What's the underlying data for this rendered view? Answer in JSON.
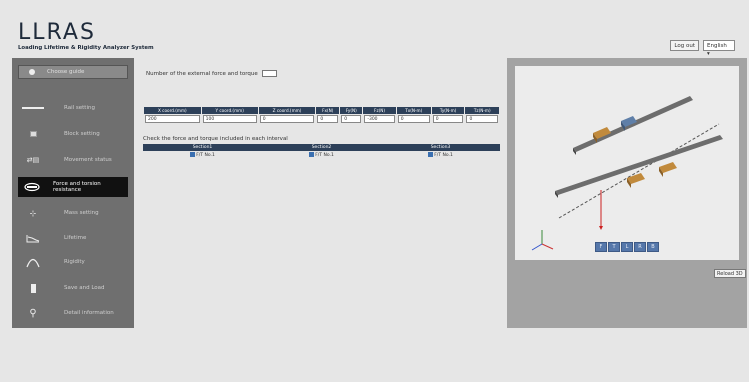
{
  "app": {
    "logo_title": "LLRAS",
    "logo_subtitle": "Loading Lifetime & Rigidity Analyzer System"
  },
  "header": {
    "logout_label": "Log out",
    "language": "English"
  },
  "sidebar": {
    "items": [
      {
        "label": "Choose guide",
        "icon": "circle-icon"
      },
      {
        "label": "Rail setting",
        "icon": "rail-icon"
      },
      {
        "label": "Block setting",
        "icon": "block-icon"
      },
      {
        "label": "Movement status",
        "icon": "movement-icon"
      },
      {
        "label": "Force and torsion resistance",
        "icon": "force-icon"
      },
      {
        "label": "Mass setting",
        "icon": "mass-icon"
      },
      {
        "label": "Lifetime",
        "icon": "lifetime-icon"
      },
      {
        "label": "Rigidity",
        "icon": "rigidity-icon"
      },
      {
        "label": "Save and Load",
        "icon": "save-icon"
      },
      {
        "label": "Detail information",
        "icon": "search-icon"
      }
    ]
  },
  "main": {
    "num_label": "Number of the external force and torque",
    "num_value": "1",
    "force_headers": [
      "X coord.(mm)",
      "Y coord.(mm)",
      "Z coord.(mm)",
      "Fx(N)",
      "Fy(N)",
      "Fz(N)",
      "Tx(N-m)",
      "Ty(N-m)",
      "Tz(N-m)"
    ],
    "force_values": [
      "200",
      "100",
      "0",
      "0",
      "0",
      "-300",
      "0",
      "0",
      "0"
    ],
    "check_label": "Check the force and torque included in each interval",
    "sections": [
      "Section1",
      "Section2",
      "Section3"
    ],
    "section_checks": [
      "F/T No.1",
      "F/T No.1",
      "F/T No.1"
    ]
  },
  "view": {
    "buttons": [
      "F",
      "T",
      "L",
      "R",
      "B"
    ],
    "reload_label": "Reload 3D"
  }
}
